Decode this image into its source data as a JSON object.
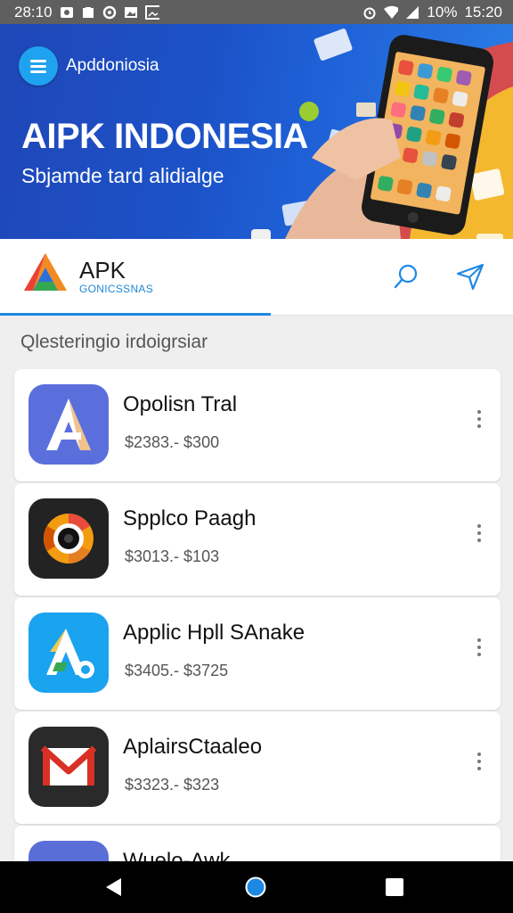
{
  "status_bar": {
    "time_left": "28:10",
    "battery": "10%",
    "time_right": "15:20",
    "icons": [
      "notification-icon",
      "mail-icon",
      "settings-icon",
      "photo-icon",
      "image-icon",
      "alarm-icon",
      "wifi-icon",
      "signal-icon"
    ]
  },
  "banner": {
    "brand": "Apddoniosia",
    "title": "AIPK INDONESIA",
    "subtitle": "Sbjamde tard alidialge"
  },
  "appbar": {
    "title": "APK",
    "subtitle": "GONICSSNAS",
    "accent": "#1e88e5"
  },
  "section": {
    "label": "Qlesteringio irdoigrsiar"
  },
  "apps": [
    {
      "name": "Opolisn Tral",
      "price": "$2383.- $300",
      "icon": "letter-a-icon"
    },
    {
      "name": "Spplco Paagh",
      "price": "$3013.- $103",
      "icon": "camera-lens-icon"
    },
    {
      "name": "Applic Hpll SAnake",
      "price": "$3405.- $3725",
      "icon": "letter-a-badge-icon"
    },
    {
      "name": "AplairsCtaaleo",
      "price": "$3323.- $323",
      "icon": "mail-envelope-icon"
    },
    {
      "name": "Wuelo-Awk",
      "price": "",
      "icon": "partial-app-icon"
    }
  ],
  "colors": {
    "banner_blue": "#1c52c8",
    "menu_button": "#1fa2ef",
    "background": "#efefef"
  }
}
